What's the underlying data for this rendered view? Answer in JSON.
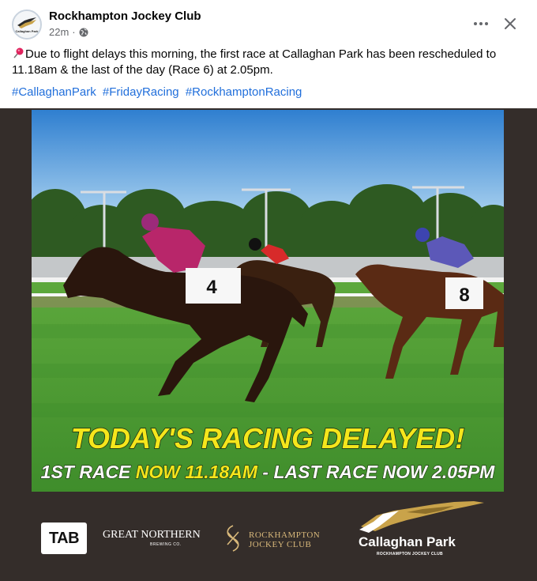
{
  "post": {
    "page_name": "Rockhampton Jockey Club",
    "avatar_text": "Callaghan Park",
    "time": "22m",
    "separator": "·",
    "privacy_icon": "globe-icon",
    "more_icon": "more-options-icon",
    "close_icon": "close-icon",
    "body": "Due to flight delays this morning, the first race at Callaghan Park has been rescheduled to 11.18am & the last of the day (Race 6) at 2.05pm.",
    "hashtags": [
      "#CallaghanPark",
      "#FridayRacing",
      "#RockhamptonRacing"
    ]
  },
  "image": {
    "headline": "TODAY'S RACING DELAYED!",
    "subline_a": "1ST RACE ",
    "subline_b": "NOW 11.18AM",
    "subline_c": " - LAST RACE NOW 2.05PM",
    "horse_numbers": [
      "4",
      "8"
    ],
    "sponsors": {
      "tab": "TAB",
      "great_northern": "GREAT NORTHERN",
      "great_northern_sub": "BREWING CO.",
      "rjc_line1": "ROCKHAMPTON",
      "rjc_line2": "JOCKEY CLUB",
      "cp_name": "Callaghan Park",
      "cp_sub": "ROCKHAMPTON JOCKEY CLUB"
    }
  },
  "colors": {
    "hashtag": "#216fdb",
    "background_dark": "#342d2a",
    "headline_yellow": "#f5e61c",
    "pin_red": "#e0245e"
  }
}
